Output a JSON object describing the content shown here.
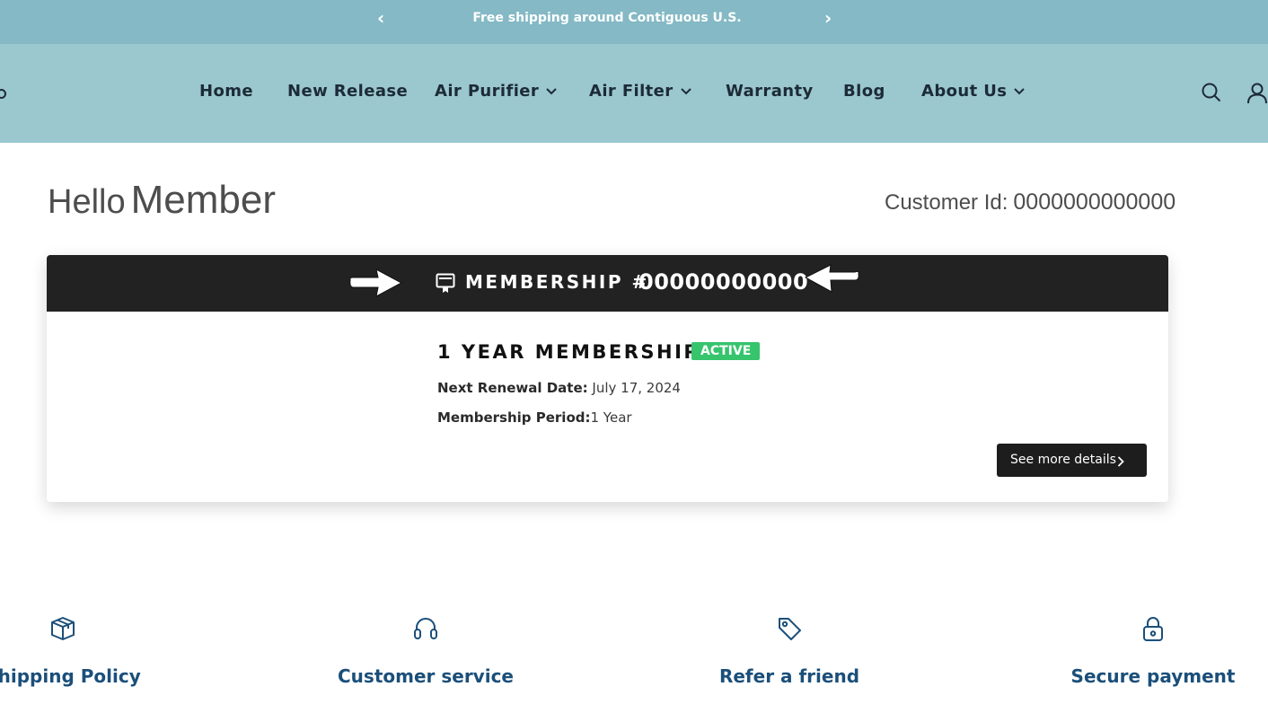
{
  "announcement": {
    "text": "Free shipping around Contiguous U.S.",
    "prev_icon": "chevron-left-icon",
    "next_icon": "chevron-right-icon"
  },
  "nav": {
    "items": [
      {
        "label": "Home"
      },
      {
        "label": "New Release"
      },
      {
        "label": "Air Purifier",
        "has_dropdown": true
      },
      {
        "label": "Air Filter",
        "has_dropdown": true
      },
      {
        "label": "Warranty"
      },
      {
        "label": "Blog"
      },
      {
        "label": "About Us",
        "has_dropdown": true
      }
    ],
    "icons": [
      "search-icon",
      "account-icon"
    ]
  },
  "greeting": {
    "hello": "Hello",
    "name": "Member"
  },
  "customer": {
    "label": "Customer Id:",
    "id": "0000000000000"
  },
  "membership": {
    "label": "MEMBERSHIP #",
    "number": "00000000000",
    "plan": "1 YEAR MEMBERSHIP",
    "status": "ACTIVE",
    "renewal_label": "Next Renewal Date:",
    "renewal_value": "July 17, 2024",
    "period_label": "Membership Period:",
    "period_value": "1 Year",
    "details_button": "See more details"
  },
  "features": [
    {
      "label": "Shipping Policy",
      "icon": "box-icon"
    },
    {
      "label": "Customer service",
      "icon": "headset-icon"
    },
    {
      "label": "Refer a friend",
      "icon": "tag-icon"
    },
    {
      "label": "Secure payment",
      "icon": "lock-icon"
    }
  ],
  "colors": {
    "announcement_bg": "#84b9c5",
    "nav_bg": "#9bc7cf",
    "membership_bar": "#222222",
    "active_badge": "#36c46c",
    "feature_text": "#1b4f7a"
  }
}
